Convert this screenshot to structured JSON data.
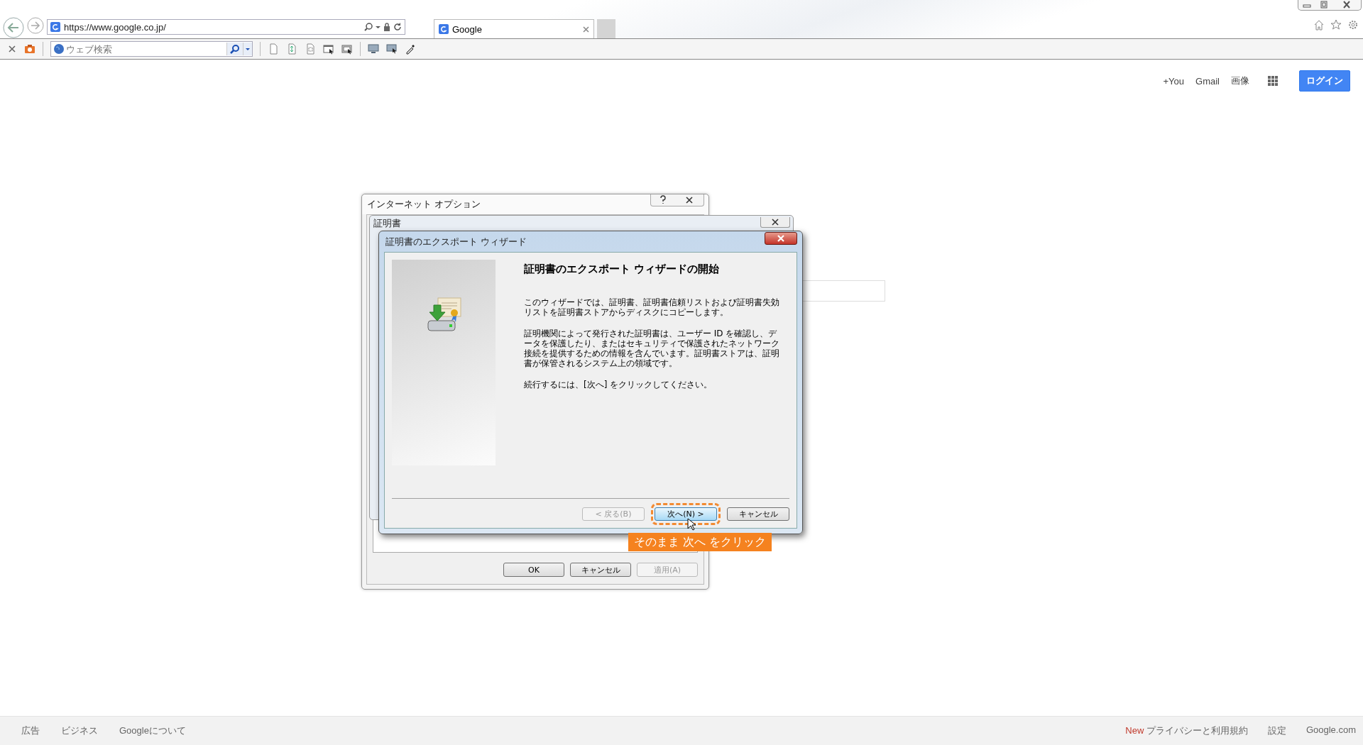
{
  "browser": {
    "address_bar": {
      "value": "https://www.google.co.jp/"
    },
    "tabs": [
      {
        "label": "Google",
        "selected": true
      }
    ],
    "toolbar": {
      "search_placeholder": "ウェブ検索"
    }
  },
  "google_header": {
    "links": [
      "+You",
      "Gmail",
      "画像"
    ],
    "login_button": "ログイン"
  },
  "internet_options": {
    "title": "インターネット オプション",
    "buttons": [
      {
        "label": "OK",
        "disabled": false
      },
      {
        "label": "キャンセル",
        "disabled": false
      },
      {
        "label": "適用(A)",
        "disabled": true
      }
    ]
  },
  "certificates": {
    "title": "証明書"
  },
  "wizard": {
    "title": "証明書のエクスポート ウィザード",
    "heading": "証明書のエクスポート ウィザードの開始",
    "paragraphs": [
      "このウィザードでは、証明書、証明書信頼リストおよび証明書失効リストを証明書ストアからディスクにコピーします。",
      "証明機関によって発行された証明書は、ユーザー ID を確認し、データを保護したり、またはセキュリティで保護されたネットワーク接続を提供するための情報を含んでいます。証明書ストアは、証明書が保管されるシステム上の領域です。",
      "続行するには、[次へ] をクリックしてください。"
    ],
    "buttons": [
      {
        "label": "< 戻る(B)",
        "disabled": true,
        "selected": false
      },
      {
        "label": "次へ(N) >",
        "disabled": false,
        "selected": true
      },
      {
        "label": "キャンセル",
        "disabled": false,
        "selected": false
      }
    ]
  },
  "annotation": {
    "text": "そのまま 次へ をクリック"
  },
  "footer": {
    "left_links": [
      "広告",
      "ビジネス",
      "Googleについて"
    ],
    "right_links": [
      {
        "badge": "New",
        "label": "プライバシーと利用規約"
      },
      {
        "label": "設定"
      },
      {
        "label": "Google.com"
      }
    ]
  }
}
